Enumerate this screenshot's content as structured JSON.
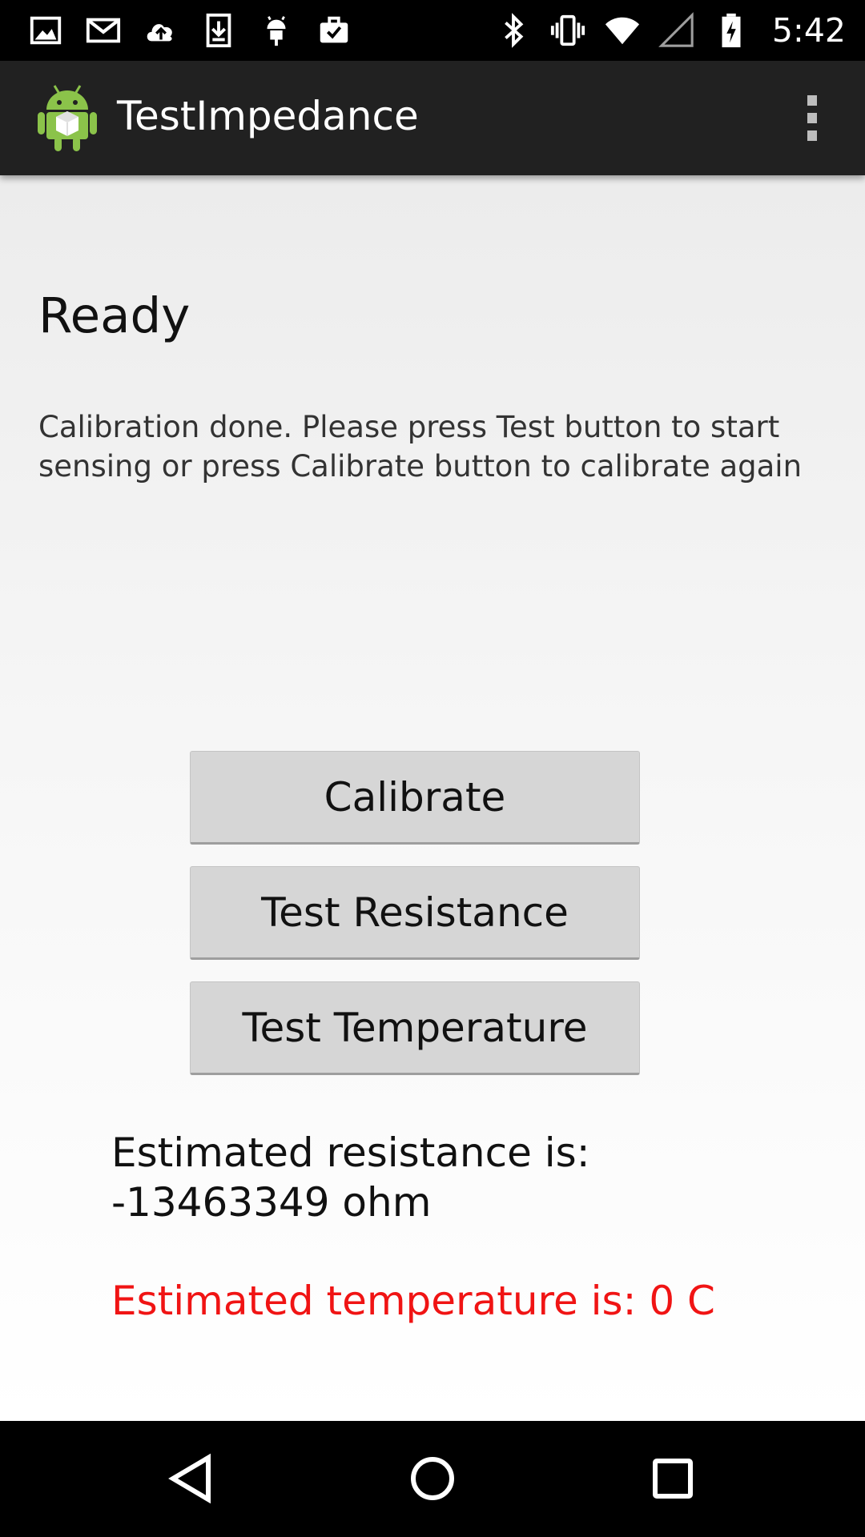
{
  "status_bar": {
    "time": "5:42",
    "notification_icons": [
      "image-icon",
      "gmail-icon",
      "cloud-upload-icon",
      "download-icon",
      "android-debug-icon",
      "briefcase-check-icon"
    ],
    "system_icons": [
      "bluetooth-icon",
      "vibrate-icon",
      "wifi-icon",
      "cellular-signal-icon",
      "battery-charging-icon"
    ]
  },
  "action_bar": {
    "title": "TestImpedance",
    "app_icon": "android-app-icon",
    "menu_icon": "overflow-menu-icon"
  },
  "main": {
    "status_title": "Ready",
    "status_message": "Calibration done. Please press Test button to start sensing or press Calibrate button to calibrate again",
    "buttons": {
      "calibrate": "Calibrate",
      "test_resistance": "Test Resistance",
      "test_temperature": "Test Temperature"
    },
    "results": {
      "resistance": "Estimated resistance is: -13463349 ohm",
      "temperature": "Estimated temperature is: 0 C"
    }
  },
  "colors": {
    "action_bar": "#212121",
    "temperature_text": "#f01414",
    "button_bg": "#d6d6d6"
  },
  "nav_bar": {
    "buttons": [
      "back-icon",
      "home-icon",
      "recents-icon"
    ]
  }
}
